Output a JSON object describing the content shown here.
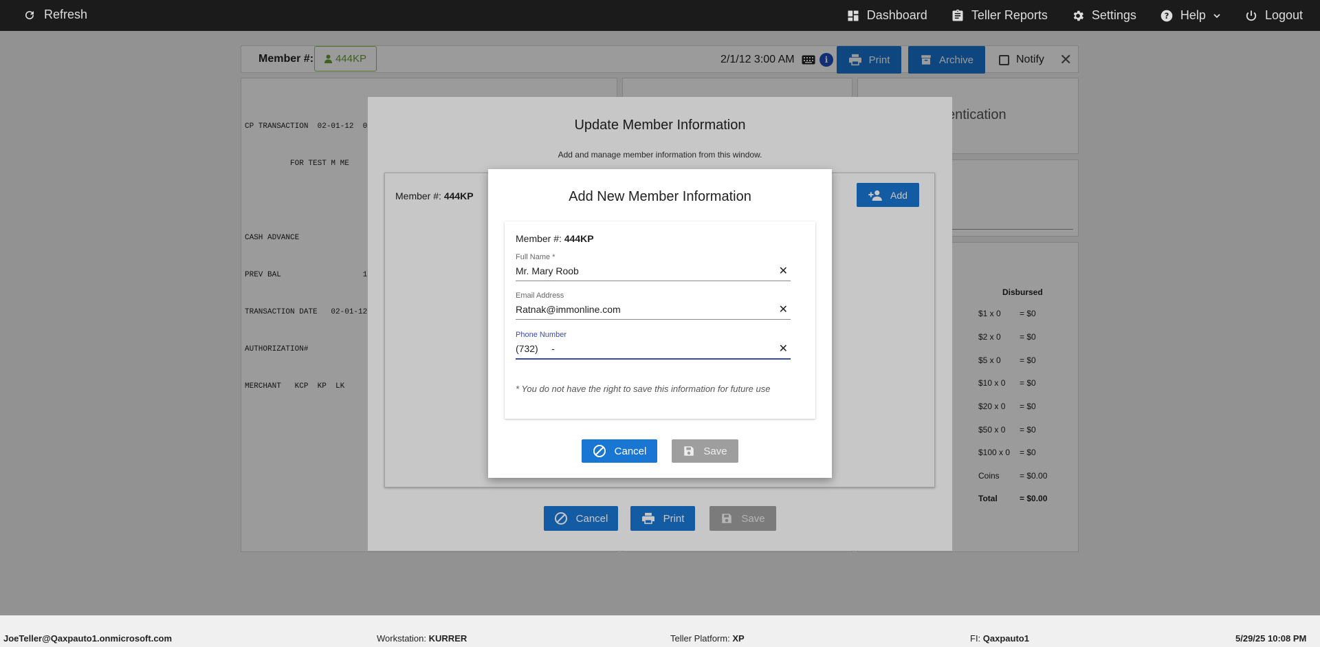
{
  "topbar": {
    "refresh_label": "Refresh",
    "nav": [
      {
        "label": "Dashboard",
        "icon": "dashboard-icon"
      },
      {
        "label": "Teller Reports",
        "icon": "clipboard-icon"
      },
      {
        "label": "Settings",
        "icon": "gear-icon"
      },
      {
        "label": "Help",
        "icon": "help-icon"
      },
      {
        "label": "Logout",
        "icon": "power-icon"
      }
    ]
  },
  "header": {
    "member_label": "Member #:",
    "member_id": "444KP",
    "datetime": "2/1/12 3:00 AM",
    "print_label": "Print",
    "archive_label": "Archive",
    "notify_label": "Notify"
  },
  "receipt": {
    "lines": [
      "CP TRANSACTION  02-01-12  0",
      "          FOR TEST M ME",
      "",
      "CASH ADVANCE",
      "PREV BAL                  1",
      "TRANSACTION DATE   02-01-12",
      "AUTHORIZATION#",
      "MERCHANT   KCP  KP  LK"
    ]
  },
  "authentication_text": "entication",
  "disbursed": {
    "header": "Disbursed",
    "rows": [
      {
        "label": "$1 x 0",
        "value": "= $0"
      },
      {
        "label": "$2 x 0",
        "value": "= $0"
      },
      {
        "label": "$5 x 0",
        "value": "= $0"
      },
      {
        "label": "$10 x 0",
        "value": "= $0"
      },
      {
        "label": "$20 x 0",
        "value": "= $0"
      },
      {
        "label": "$50 x 0",
        "value": "= $0"
      },
      {
        "label": "$100 x 0",
        "value": "= $0"
      },
      {
        "label": "Coins",
        "value": "= $0.00"
      },
      {
        "label": "Total",
        "value": "= $0.00"
      }
    ]
  },
  "update_dialog": {
    "title": "Update Member Information",
    "subtitle": "Add and manage member information from this window.",
    "member_label": "Member #:",
    "member_id": "444KP",
    "add_label": "Add",
    "cancel_label": "Cancel",
    "print_label": "Print",
    "save_label": "Save"
  },
  "add_dialog": {
    "title": "Add New Member Information",
    "member_label": "Member #:",
    "member_id": "444KP",
    "full_name_label": "Full Name *",
    "full_name_value": "Mr. Mary Roob",
    "email_label": "Email Address",
    "email_value": "Ratnak@immonline.com",
    "phone_label": "Phone Number",
    "phone_value": "(732)     -",
    "note": "* You do not have the right to save this information for future use",
    "cancel_label": "Cancel",
    "save_label": "Save"
  },
  "statusbar": {
    "user": "JoeTeller@Qaxpauto1.onmicrosoft.com",
    "workstation_label": "Workstation:",
    "workstation_value": "KURRER",
    "platform_label": "Teller Platform:",
    "platform_value": "XP",
    "fi_label": "FI:",
    "fi_value": "Qaxpauto1",
    "datetime": "5/29/25 10:08 PM"
  }
}
